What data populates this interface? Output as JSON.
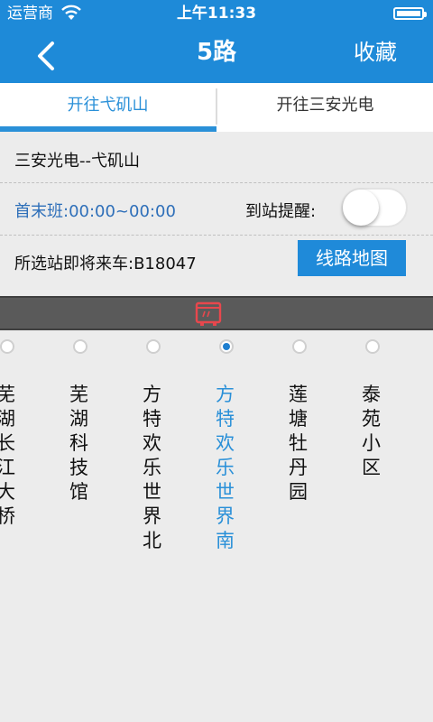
{
  "status_bar": {
    "carrier": "运营商",
    "time": "上午11:33"
  },
  "nav": {
    "title": "5路",
    "favorite_label": "收藏",
    "back_icon": "chevron-left-icon"
  },
  "tabs": [
    {
      "label": "开往弋矶山",
      "active": true
    },
    {
      "label": "开往三安光电",
      "active": false
    }
  ],
  "info": {
    "route_line": "三安光电--弋矶山",
    "service_hours": "首末班:00:00~00:00",
    "arrival_reminder_label": "到站提醒:",
    "arrival_reminder_on": false,
    "next_bus": "所选站即将来车:B18047",
    "map_button_label": "线路地图"
  },
  "stops": [
    {
      "name": "芜湖长江大桥",
      "selected": false
    },
    {
      "name": "芜湖科技馆",
      "selected": false
    },
    {
      "name": "方特欢乐世界北",
      "selected": false
    },
    {
      "name": "方特欢乐世界南",
      "selected": true
    },
    {
      "name": "莲塘牡丹园",
      "selected": false
    },
    {
      "name": "泰苑小区",
      "selected": false
    }
  ],
  "colors": {
    "primary": "#1e8ad8",
    "accent_text": "#2a90d8",
    "route_bar": "#5a5a5a",
    "bus_icon": "#e8474d"
  }
}
